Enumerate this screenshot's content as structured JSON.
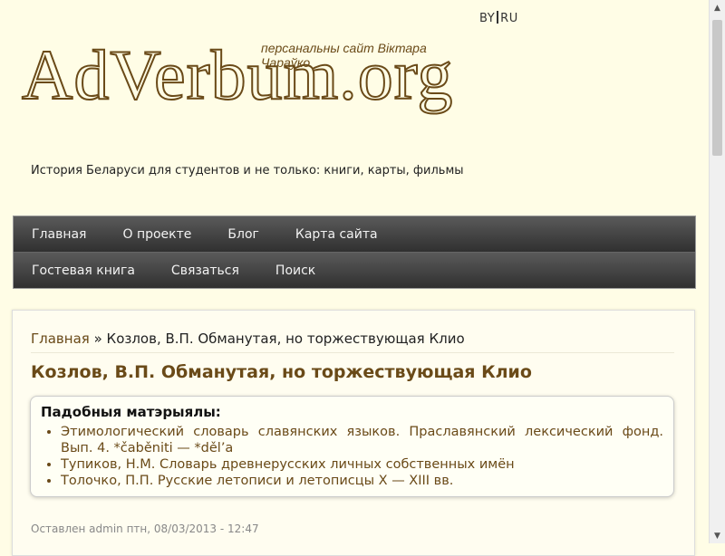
{
  "header": {
    "lang_by": "BY",
    "lang_ru": "RU",
    "logo": "AdVerbum.org",
    "logo_tagline": "персанальны сайт Віктара Чараўко",
    "subtitle": "История Беларуси для студентов и не только: книги, карты, фильмы"
  },
  "nav": {
    "row1": [
      "Главная",
      "О проекте",
      "Блог",
      "Карта сайта"
    ],
    "row2": [
      "Гостевая книга",
      "Связаться",
      "Поиск"
    ]
  },
  "breadcrumb": {
    "home": "Главная",
    "separator": "»",
    "current": "Козлов, В.П. Обманутая, но торжествующая Клио"
  },
  "page": {
    "title": "Козлов, В.П. Обманутая, но торжествующая Клио"
  },
  "related": {
    "heading": "Падобныя матэрыялы:",
    "items": [
      "Этимологический словарь славянских языков. Праславянский лексический фонд. Вып. 4. *čaběniti — *děl’a",
      "Тупиков, Н.М. Словарь древнерусских личных собственных имён",
      "Толочко, П.П. Русские летописи и летописцы X — XIII вв."
    ]
  },
  "meta": {
    "text": "Оставлен admin птн, 08/03/2013 - 12:47"
  },
  "icons": {
    "scroll_up": "arrow-up-icon",
    "scroll_down": "arrow-down-icon"
  },
  "colors": {
    "background": "#fffde6",
    "brand_brown": "#6a4a18",
    "nav_dark": "#3c3c3c"
  }
}
